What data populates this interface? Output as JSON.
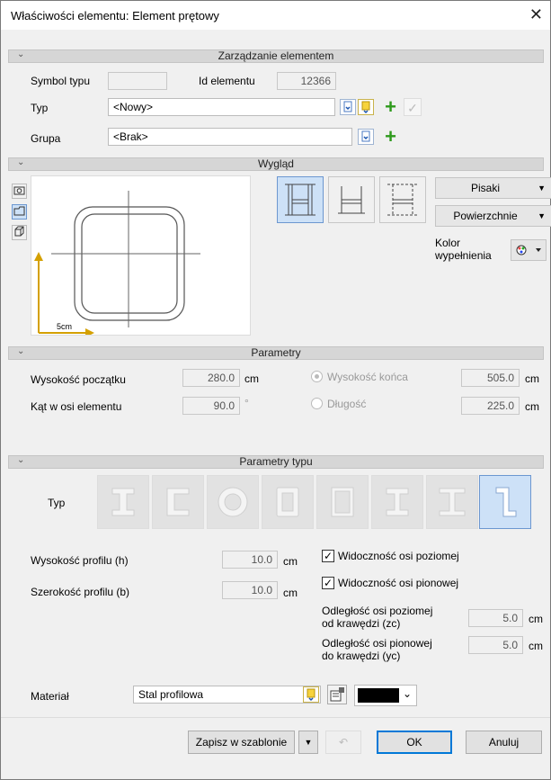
{
  "window": {
    "title": "Właściwości elementu: Element prętowy",
    "close": "✕"
  },
  "sections": {
    "management": "Zarządzanie elementem",
    "appearance": "Wygląd",
    "params": "Parametry",
    "type_params": "Parametry typu"
  },
  "management": {
    "symbol_label": "Symbol typu",
    "symbol_value": "",
    "id_label": "Id elementu",
    "id_value": "12366",
    "type_label": "Typ",
    "type_value": "<Nowy>",
    "group_label": "Grupa",
    "group_value": "<Brak>"
  },
  "appearance": {
    "scale_label": "5cm",
    "pens_label": "Pisaki",
    "surfaces_label": "Powierzchnie",
    "fill_color_label1": "Kolor",
    "fill_color_label2": "wypełnienia"
  },
  "params": {
    "start_height_label": "Wysokość początku",
    "start_height_value": "280.0",
    "start_height_unit": "cm",
    "axis_angle_label": "Kąt w osi elementu",
    "axis_angle_value": "90.0",
    "axis_angle_unit": "°",
    "end_height_label": "Wysokość końca",
    "end_height_value": "505.0",
    "end_height_unit": "cm",
    "length_label": "Długość",
    "length_value": "225.0",
    "length_unit": "cm",
    "end_height_selected": true
  },
  "type_params": {
    "type_label": "Typ",
    "profile_types": [
      "I-beam",
      "C-channel",
      "round-tube",
      "rect-tube",
      "rect-tube-thin",
      "T-section",
      "I-section",
      "L-angle"
    ],
    "selected_index": 7,
    "height_label": "Wysokość profilu (h)",
    "height_value": "10.0",
    "height_unit": "cm",
    "width_label": "Szerokość profilu (b)",
    "width_value": "10.0",
    "width_unit": "cm",
    "horiz_axis_visible_label": "Widoczność osi poziomej",
    "vert_axis_visible_label": "Widoczność osi pionowej",
    "horiz_axis_visible": true,
    "vert_axis_visible": true,
    "zc_label1": "Odległość osi poziomej",
    "zc_label2": "od krawędzi (zc)",
    "zc_value": "5.0",
    "zc_unit": "cm",
    "yc_label1": "Odległość osi pionowej",
    "yc_label2": "do krawędzi (yc)",
    "yc_value": "5.0",
    "yc_unit": "cm"
  },
  "material": {
    "label": "Materiał",
    "value": "Stal profilowa",
    "color": "#000000"
  },
  "footer": {
    "save_template": "Zapisz w szablonie",
    "ok": "OK",
    "cancel": "Anuluj"
  },
  "colors": {
    "accent": "#0078d7",
    "selected_bg": "#cde1f7",
    "preview_axis": "#d4a000",
    "plus_green": "#2e9a1c"
  }
}
